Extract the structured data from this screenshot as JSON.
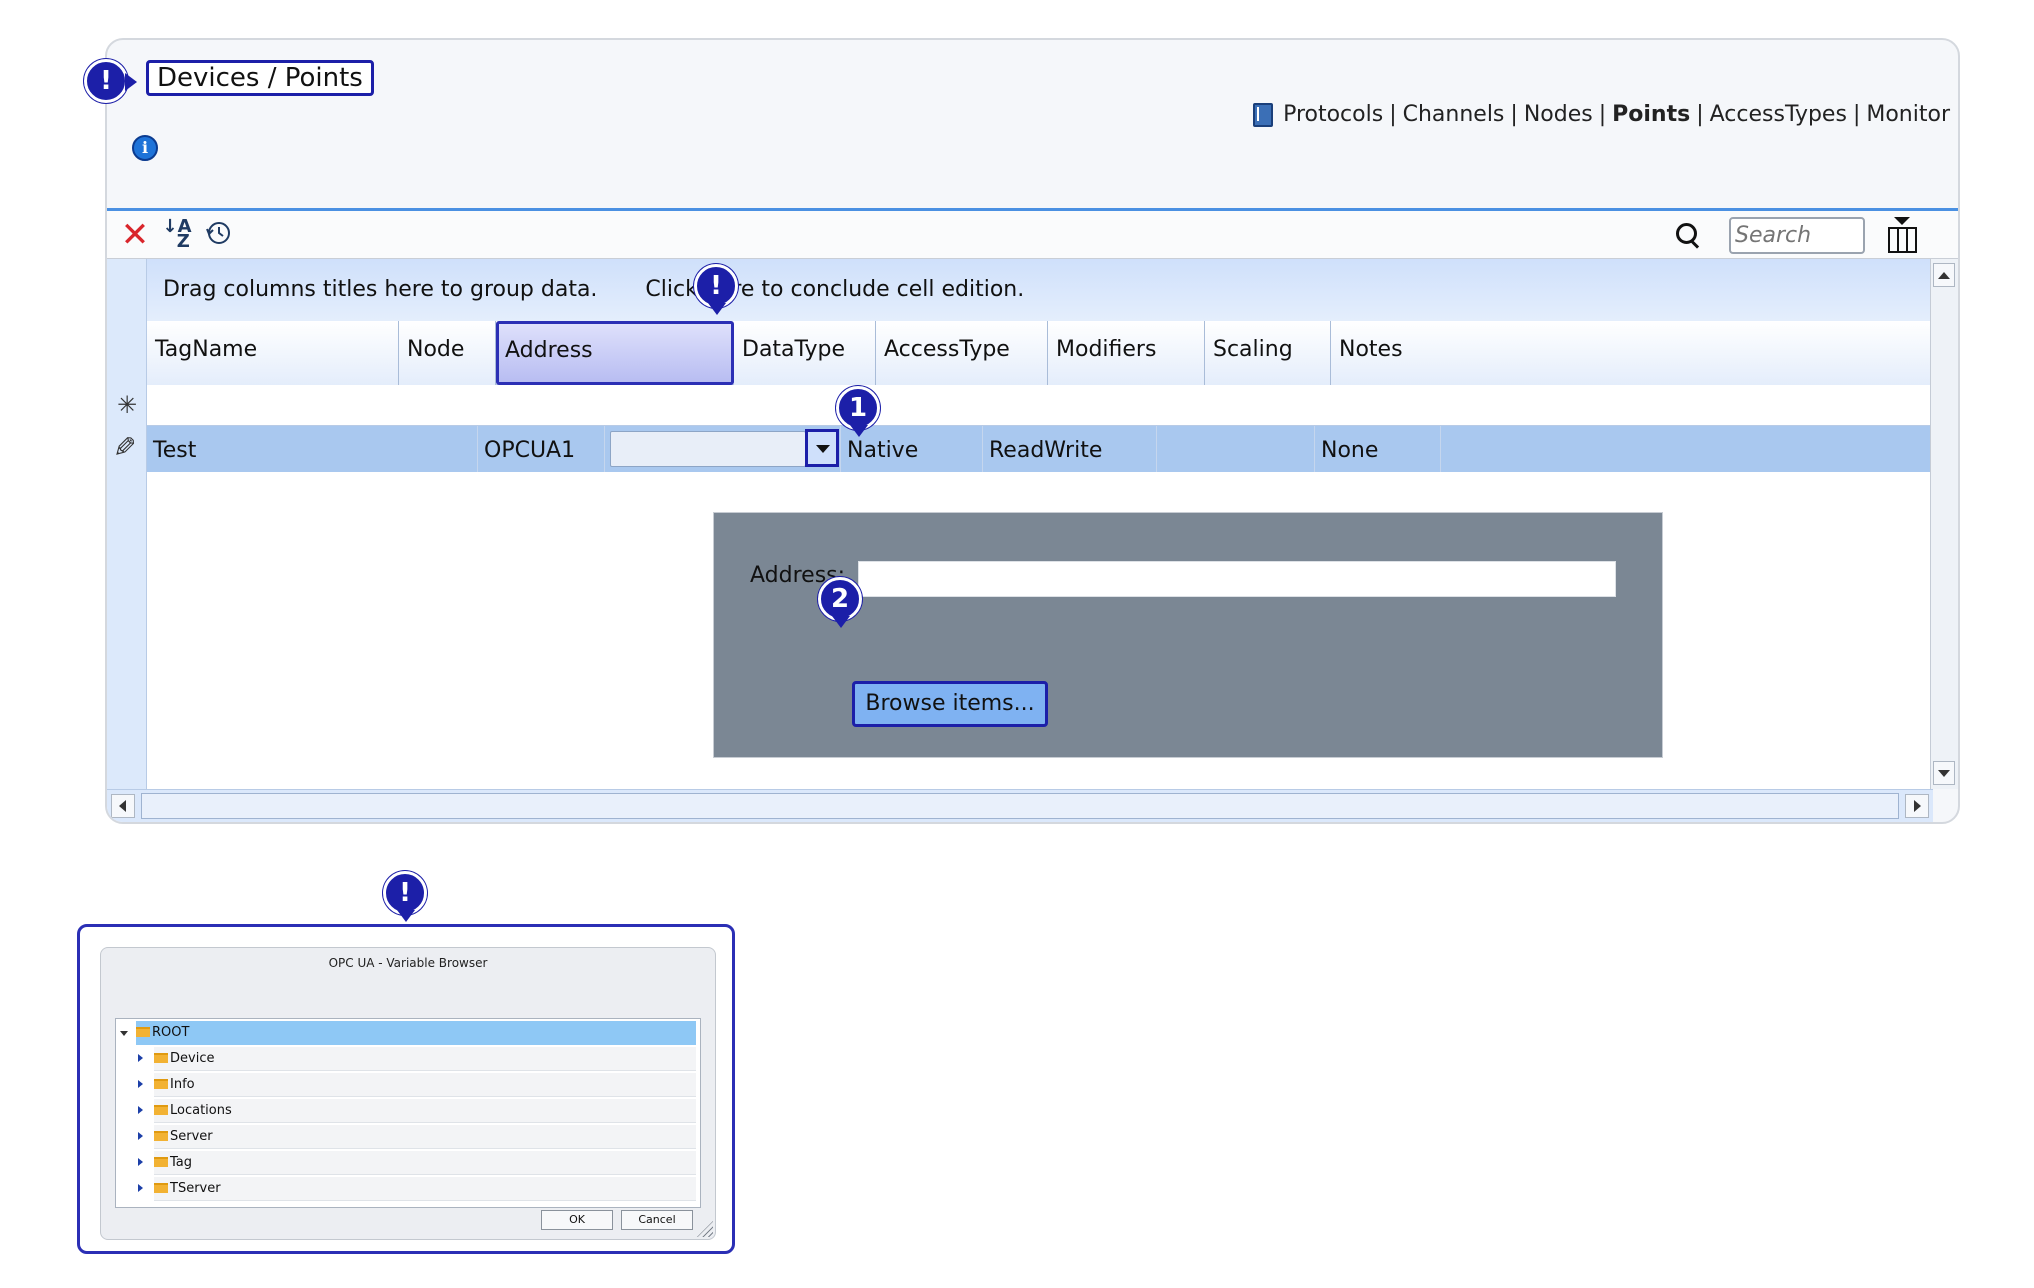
{
  "breadcrumb": "Devices / Points",
  "nav": {
    "items": [
      "Protocols",
      "Channels",
      "Nodes",
      "Points",
      "AccessTypes",
      "Monitor"
    ],
    "active": "Points",
    "separator": "|"
  },
  "toolbar": {
    "search_placeholder": "Search"
  },
  "grid": {
    "group_hint": "Drag columns titles here to group data.",
    "conclude_hint": "Click here to conclude cell edition.",
    "columns": [
      "TagName",
      "Node",
      "Address",
      "DataType",
      "AccessType",
      "Modifiers",
      "Scaling",
      "Notes"
    ],
    "selected_column": "Address",
    "row": {
      "tagname": "Test",
      "node": "OPCUA1",
      "address": "",
      "datatype": "Native",
      "accesstype": "ReadWrite",
      "modifiers": "",
      "scaling": "None",
      "notes": ""
    }
  },
  "address_popup": {
    "label": "Address:",
    "value": "",
    "browse_button": "Browse items..."
  },
  "markers": {
    "warning": "!",
    "step1": "1",
    "step2": "2"
  },
  "browser_dialog": {
    "title": "OPC UA - Variable Browser",
    "root": "ROOT",
    "children": [
      "Device",
      "Info",
      "Locations",
      "Server",
      "Tag",
      "TServer"
    ],
    "ok": "OK",
    "cancel": "Cancel"
  },
  "colors": {
    "accent": "#1c1fa8",
    "row_selected": "#a9c8ef",
    "popup_bg": "#7b8794",
    "delete_red": "#d9262c"
  }
}
